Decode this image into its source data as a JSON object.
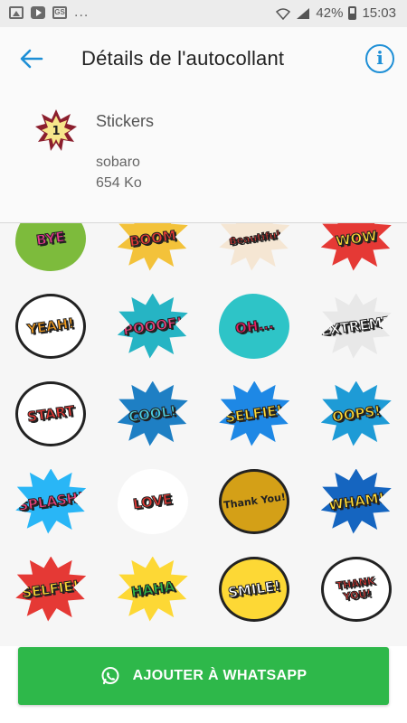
{
  "status_bar": {
    "left_icons": [
      "image-icon",
      "youtube-icon",
      "gs-icon"
    ],
    "overflow": "...",
    "battery": "42%",
    "time": "15:03"
  },
  "app_bar": {
    "title": "Détails de l'autocollant",
    "back_icon": "arrow-left-icon",
    "info_icon": "info-icon",
    "info_glyph": "i",
    "accent": "#1e8fd6"
  },
  "pack": {
    "icon_text": "1",
    "name": "Stickers",
    "author": "sobaro",
    "size": "654 Ko"
  },
  "stickers": [
    [
      {
        "text": "BYE",
        "shape": "cloud",
        "bg": "#7dbb3c",
        "fg": "#e63b8d"
      },
      {
        "text": "BOOM",
        "shape": "burst",
        "bg": "#f3c23a",
        "fg": "#e53935"
      },
      {
        "text": "Beautiful",
        "shape": "burst",
        "bg": "#f5e6d3",
        "fg": "#e53935"
      },
      {
        "text": "WOW",
        "shape": "burst",
        "bg": "#e53935",
        "fg": "#fdd835"
      }
    ],
    [
      {
        "text": "YEAH!",
        "shape": "bubble",
        "bg": "#ffffff",
        "fg": "#f29b1f"
      },
      {
        "text": "POOOF!",
        "shape": "burst",
        "bg": "#26b4c4",
        "fg": "#ec407a"
      },
      {
        "text": "OH...",
        "shape": "cloud",
        "bg": "#2ec4c7",
        "fg": "#e91e63"
      },
      {
        "text": "EXTREME",
        "shape": "burst",
        "bg": "#e8e8e8",
        "fg": "#ffffff"
      }
    ],
    [
      {
        "text": "START",
        "shape": "bubble",
        "bg": "#ffffff",
        "fg": "#e53935"
      },
      {
        "text": "COOL!",
        "shape": "burst",
        "bg": "#1e7fc4",
        "fg": "#4dd0e1"
      },
      {
        "text": "SELFIE!",
        "shape": "burst",
        "bg": "#1e88e5",
        "fg": "#fdd835"
      },
      {
        "text": "OOPS!",
        "shape": "burst",
        "bg": "#1e9bd6",
        "fg": "#fdd835"
      }
    ],
    [
      {
        "text": "SPLASH!",
        "shape": "burst",
        "bg": "#29b6f6",
        "fg": "#ec407a"
      },
      {
        "text": "LOVE",
        "shape": "cloud",
        "bg": "#ffffff",
        "fg": "#e53935"
      },
      {
        "text": "Thank You!",
        "shape": "round",
        "bg": "#d4a017",
        "fg": "#222222"
      },
      {
        "text": "WHAM!",
        "shape": "burst",
        "bg": "#1565c0",
        "fg": "#fdd835"
      }
    ],
    [
      {
        "text": "SELFIE!",
        "shape": "burst",
        "bg": "#e53935",
        "fg": "#fdd835"
      },
      {
        "text": "HAHA",
        "shape": "burst",
        "bg": "#fdd835",
        "fg": "#2eb84a"
      },
      {
        "text": "SMILE!",
        "shape": "bubble",
        "bg": "#fdd835",
        "fg": "#ffffff"
      },
      {
        "text": "THANK YOU!",
        "shape": "round",
        "bg": "#ffffff",
        "fg": "#e53935"
      }
    ]
  ],
  "add_button": {
    "label": "AJOUTER À WHATSAPP",
    "icon": "whatsapp-icon",
    "color": "#2eb84a"
  }
}
